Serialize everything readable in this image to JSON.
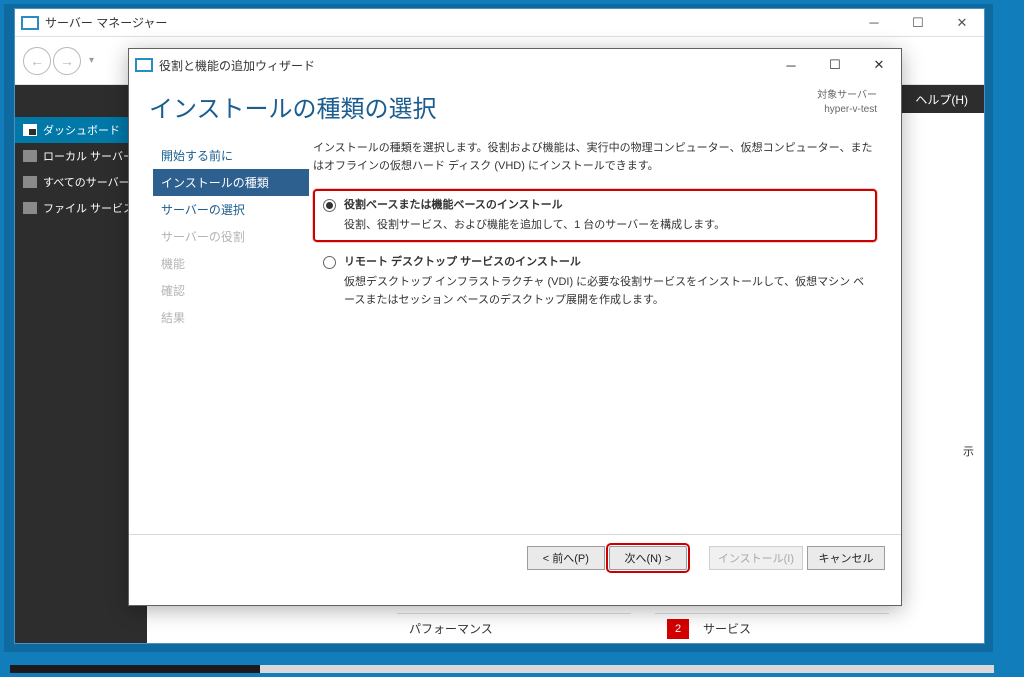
{
  "server_manager": {
    "title": "サーバー マネージャー",
    "menubar": {
      "help": "ヘルプ(H)"
    },
    "sidebar": [
      {
        "label": "ダッシュボード",
        "selected": true
      },
      {
        "label": "ローカル サーバー"
      },
      {
        "label": "すべてのサーバー"
      },
      {
        "label": "ファイル サービス"
      }
    ],
    "main_partial_text": "示",
    "tiles": {
      "performance": "パフォーマンス",
      "services_badge": "2",
      "services": "サービス"
    }
  },
  "wizard": {
    "title": "役割と機能の追加ウィザード",
    "heading": "インストールの種類の選択",
    "target_label": "対象サーバー",
    "target_server": "hyper-v-test",
    "steps": [
      {
        "label": "開始する前に",
        "state": "normal"
      },
      {
        "label": "インストールの種類",
        "state": "active"
      },
      {
        "label": "サーバーの選択",
        "state": "normal"
      },
      {
        "label": "サーバーの役割",
        "state": "disabled"
      },
      {
        "label": "機能",
        "state": "disabled"
      },
      {
        "label": "確認",
        "state": "disabled"
      },
      {
        "label": "結果",
        "state": "disabled"
      }
    ],
    "intro": "インストールの種類を選択します。役割および機能は、実行中の物理コンピューター、仮想コンピューター、またはオフラインの仮想ハード ディスク (VHD) にインストールできます。",
    "options": [
      {
        "title": "役割ベースまたは機能ベースのインストール",
        "desc": "役割、役割サービス、および機能を追加して、1 台のサーバーを構成します。",
        "checked": true,
        "highlight": true
      },
      {
        "title": "リモート デスクトップ サービスのインストール",
        "desc": "仮想デスクトップ インフラストラクチャ (VDI) に必要な役割サービスをインストールして、仮想マシン ベースまたはセッション ベースのデスクトップ展開を作成します。",
        "checked": false,
        "highlight": false
      }
    ],
    "buttons": {
      "prev": "< 前へ(P)",
      "next": "次へ(N) >",
      "install": "インストール(I)",
      "cancel": "キャンセル"
    }
  }
}
